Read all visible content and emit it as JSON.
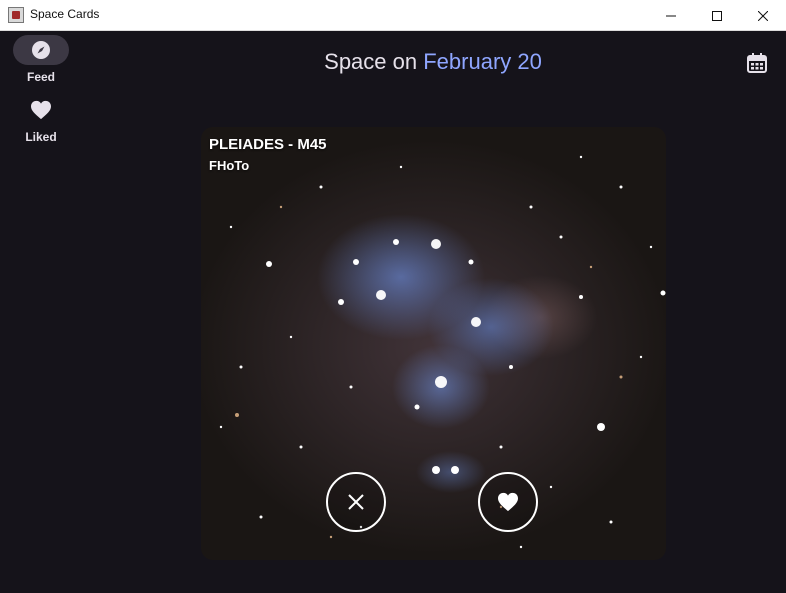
{
  "window": {
    "title": "Space Cards",
    "icon": "app-icon",
    "controls": [
      "minimize-icon",
      "maximize-icon",
      "close-icon"
    ]
  },
  "nav": {
    "items": [
      {
        "label": "Feed",
        "icon": "compass-icon",
        "active": true
      },
      {
        "label": "Liked",
        "icon": "heart-icon",
        "active": false
      }
    ]
  },
  "header": {
    "prefix": "Space on",
    "date": "February 20",
    "calendar_icon": "calendar-icon",
    "date_color": "#8fa6ff"
  },
  "card": {
    "title": "PLEIADES - M45",
    "author": "FHoTo",
    "image": "star-cluster-photo",
    "actions": [
      {
        "icon": "x-icon"
      },
      {
        "icon": "heart-icon"
      }
    ]
  },
  "colors": {
    "background": "#15131a",
    "nav_active": "#3c3844",
    "text": "#e6e1ea"
  }
}
